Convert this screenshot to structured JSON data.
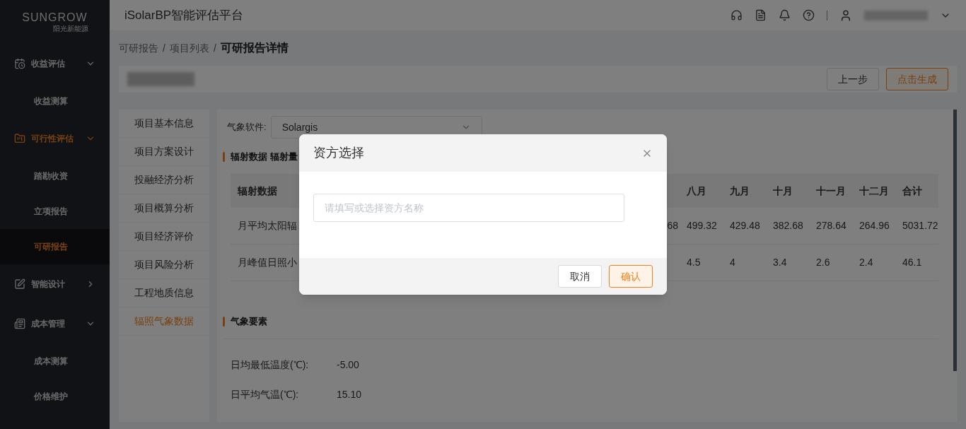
{
  "logo": {
    "name": "SUNGROW",
    "tagline": "阳光新能源"
  },
  "header": {
    "title": "iSolarBP智能评估平台"
  },
  "sidebar": {
    "items": [
      {
        "label": "收益评估",
        "expanded": true,
        "active": false,
        "children": [
          {
            "label": "收益测算",
            "selected": false
          }
        ]
      },
      {
        "label": "可行性评估",
        "expanded": true,
        "active": true,
        "children": [
          {
            "label": "踏勘收资",
            "selected": false
          },
          {
            "label": "立项报告",
            "selected": false
          },
          {
            "label": "可研报告",
            "selected": true
          }
        ]
      },
      {
        "label": "智能设计",
        "expanded": false,
        "active": false
      },
      {
        "label": "成本管理",
        "expanded": true,
        "active": false,
        "children": [
          {
            "label": "成本测算",
            "selected": false
          },
          {
            "label": "价格维护",
            "selected": false
          }
        ]
      }
    ]
  },
  "breadcrumb": {
    "separator": "/",
    "items": [
      "可研报告",
      "项目列表",
      "可研报告详情"
    ]
  },
  "actions": [
    {
      "label": "上一步",
      "kind": "default"
    },
    {
      "label": "点击生成",
      "kind": "primary"
    }
  ],
  "nav": [
    {
      "label": "项目基本信息",
      "selected": false
    },
    {
      "label": "项目方案设计",
      "selected": false
    },
    {
      "label": "投融经济分析",
      "selected": false
    },
    {
      "label": "项目概算分析",
      "selected": false
    },
    {
      "label": "项目经济评价",
      "selected": false
    },
    {
      "label": "项目风险分析",
      "selected": false
    },
    {
      "label": "工程地质信息",
      "selected": false
    },
    {
      "label": "辐照气象数据",
      "selected": true
    }
  ],
  "weather_software": {
    "label": "气象软件:",
    "value": "Solargis"
  },
  "radiation": {
    "title": "辐射数据 辐射量",
    "columns": [
      "辐射数据",
      "",
      "八月",
      "九月",
      "十月",
      "十一月",
      "十二月",
      "合计"
    ],
    "rows": [
      [
        "月平均太阳辐",
        "68",
        "499.32",
        "429.48",
        "382.68",
        "278.64",
        "264.96",
        "5031.72"
      ],
      [
        "月峰值日照小",
        "",
        "4.5",
        "4",
        "3.4",
        "2.6",
        "2.4",
        "46.1"
      ]
    ]
  },
  "weather": {
    "title": "气象要素",
    "fields": [
      {
        "label": "日均最低温度(℃):",
        "value": "-5.00"
      },
      {
        "label": "日平均气温(℃):",
        "value": "15.10"
      }
    ]
  },
  "dialog": {
    "title": "资方选择",
    "placeholder": "请填写或选择资方名称",
    "buttons": [
      {
        "label": "取消",
        "kind": "default"
      },
      {
        "label": "确认",
        "kind": "primary"
      }
    ]
  }
}
